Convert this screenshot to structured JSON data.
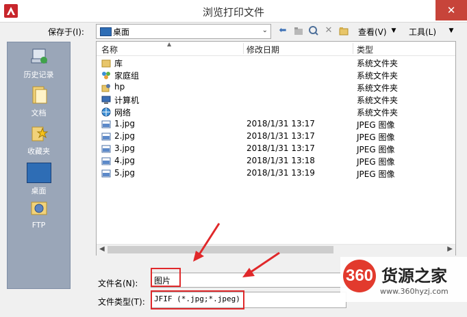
{
  "window": {
    "title": "浏览打印文件",
    "close_label": "✕"
  },
  "toolbar": {
    "save_in_label": "保存于(I):",
    "location": "桌面",
    "view_label": "查看(V)",
    "tools_label": "工具(L)"
  },
  "places": [
    {
      "label": "历史记录",
      "icon": "history-icon"
    },
    {
      "label": "文档",
      "icon": "documents-icon"
    },
    {
      "label": "收藏夹",
      "icon": "favorites-icon"
    },
    {
      "label": "桌面",
      "icon": "desktop-icon"
    },
    {
      "label": "FTP",
      "icon": "ftp-icon"
    }
  ],
  "file_list": {
    "columns": [
      "名称",
      "修改日期",
      "类型"
    ],
    "rows": [
      {
        "name": "库",
        "date": "",
        "type": "系统文件夹",
        "icon": "library-icon"
      },
      {
        "name": "家庭组",
        "date": "",
        "type": "系统文件夹",
        "icon": "homegroup-icon"
      },
      {
        "name": "hp",
        "date": "",
        "type": "系统文件夹",
        "icon": "user-folder-icon"
      },
      {
        "name": "计算机",
        "date": "",
        "type": "系统文件夹",
        "icon": "computer-icon"
      },
      {
        "name": "网络",
        "date": "",
        "type": "系统文件夹",
        "icon": "network-icon"
      },
      {
        "name": "1.jpg",
        "date": "2018/1/31 13:17",
        "type": "JPEG 图像",
        "icon": "image-file-icon"
      },
      {
        "name": "2.jpg",
        "date": "2018/1/31 13:17",
        "type": "JPEG 图像",
        "icon": "image-file-icon"
      },
      {
        "name": "3.jpg",
        "date": "2018/1/31 13:17",
        "type": "JPEG 图像",
        "icon": "image-file-icon"
      },
      {
        "name": "4.jpg",
        "date": "2018/1/31 13:18",
        "type": "JPEG 图像",
        "icon": "image-file-icon"
      },
      {
        "name": "5.jpg",
        "date": "2018/1/31 13:19",
        "type": "JPEG 图像",
        "icon": "image-file-icon"
      }
    ]
  },
  "form": {
    "filename_label": "文件名(N):",
    "filename_value": "图片",
    "filetype_label": "文件类型(T):",
    "filetype_value": "JFIF (*.jpg;*.jpeg)"
  },
  "watermark": {
    "logo": "360",
    "text": "货源之家",
    "url": "www.360hyzj.com"
  },
  "colors": {
    "highlight": "#e0282a",
    "accent": "#2e6db5",
    "close": "#c7443a"
  }
}
